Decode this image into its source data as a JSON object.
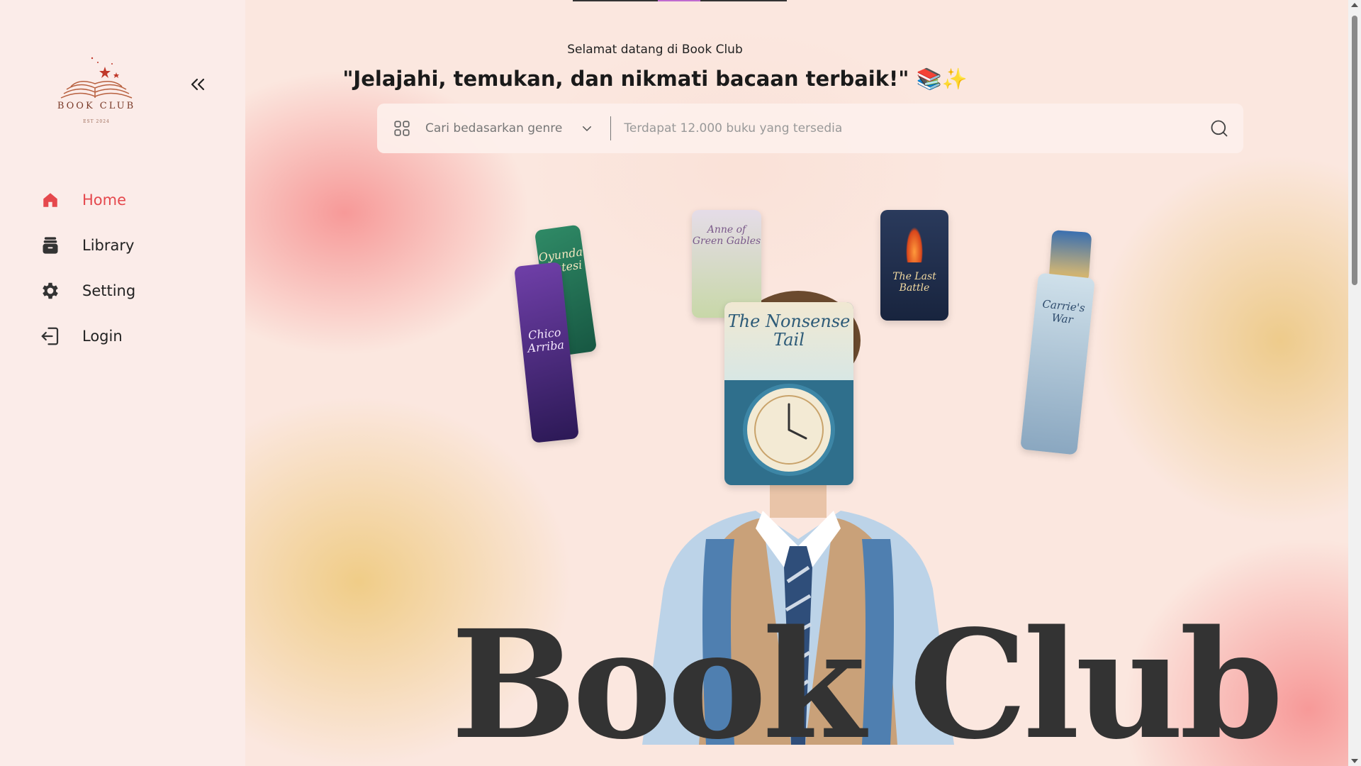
{
  "sidebar": {
    "logo": {
      "text": "BOOK CLUB",
      "est": "EST 2024"
    },
    "items": [
      {
        "label": "Home",
        "icon": "home-icon",
        "active": true
      },
      {
        "label": "Library",
        "icon": "library-icon",
        "active": false
      },
      {
        "label": "Setting",
        "icon": "gear-icon",
        "active": false
      },
      {
        "label": "Login",
        "icon": "login-icon",
        "active": false
      }
    ]
  },
  "header": {
    "welcome": "Selamat datang di Book Club",
    "headline": "\"Jelajahi, temukan, dan nikmati bacaan terbaik!\" 📚✨"
  },
  "search": {
    "genre_label": "Cari bedasarkan genre",
    "placeholder": "Terdapat 12.000 buku yang tersedia"
  },
  "hero": {
    "title": "Book Club",
    "books": [
      {
        "title": "Oyunda Mutesi"
      },
      {
        "title": "Chico Arriba"
      },
      {
        "title": "Anne of Green Gables"
      },
      {
        "title": "The Nonsense Tail"
      },
      {
        "title": "The Last Battle"
      },
      {
        "title": "Carrie's War"
      }
    ]
  },
  "colors": {
    "accent": "#e5484d",
    "sidebar_bg": "#fbece9",
    "text": "#222222"
  }
}
